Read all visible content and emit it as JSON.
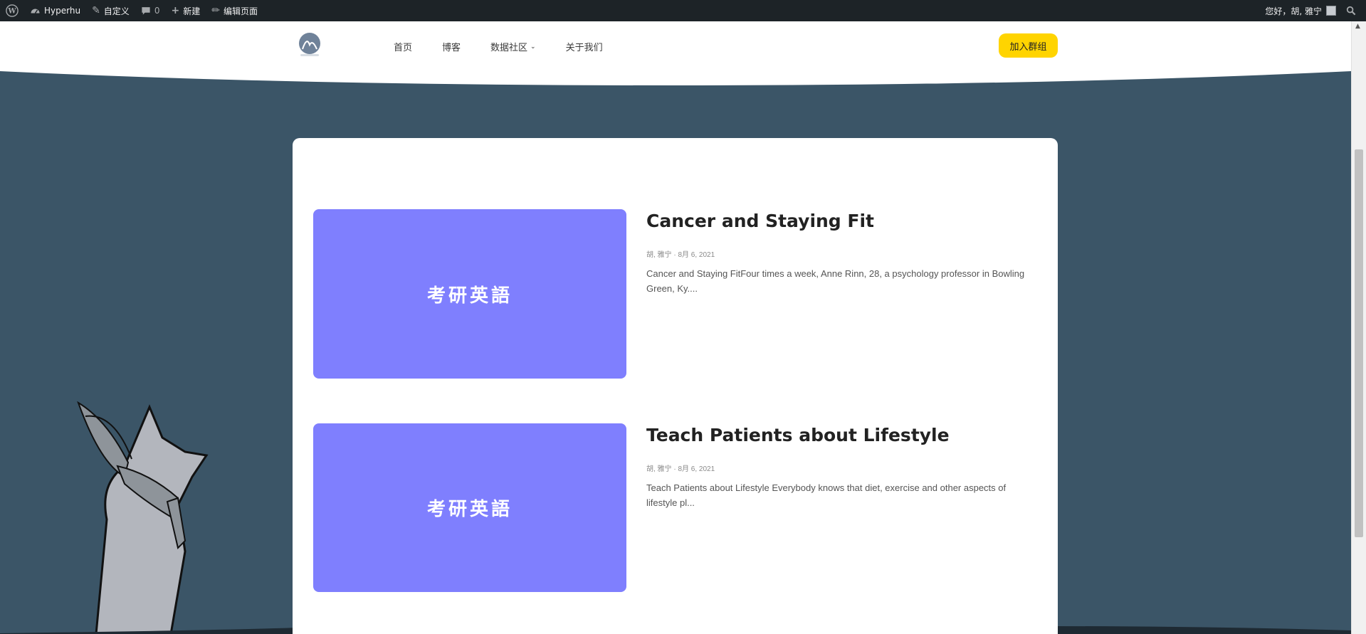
{
  "adminbar": {
    "site_name": "Hyperhu",
    "customize_label": "自定义",
    "comments_count": "0",
    "new_label": "新建",
    "edit_page_label": "编辑页面",
    "greeting": "您好，胡, 雅宁"
  },
  "header": {
    "nav": [
      {
        "label": "首页"
      },
      {
        "label": "博客"
      },
      {
        "label": "数据社区"
      },
      {
        "label": "关于我们"
      }
    ],
    "join_button": "加入群组"
  },
  "posts": [
    {
      "thumb_text": "考研英語",
      "title": "Cancer and Staying Fit",
      "meta": "胡, 雅宁 · 8月 6, 2021",
      "excerpt": "Cancer and Staying FitFour times a week, Anne Rinn, 28, a psychology professor in Bowling Green, Ky...."
    },
    {
      "thumb_text": "考研英語",
      "title": "Teach Patients about Lifestyle",
      "meta": "胡, 雅宁 · 8月 6, 2021",
      "excerpt": "Teach Patients about Lifestyle    Everybody knows that diet, exercise and other aspects of lifestyle pl..."
    }
  ],
  "colors": {
    "background": "#3b5567",
    "adminbar": "#1d2327",
    "accent_button": "#ffd400",
    "thumbnail": "#7f7ffe"
  },
  "icons": [
    "wordpress-icon",
    "dashboard-icon",
    "brush-icon",
    "comment-icon",
    "plus-icon",
    "pencil-icon",
    "search-icon",
    "chevron-down-icon"
  ]
}
